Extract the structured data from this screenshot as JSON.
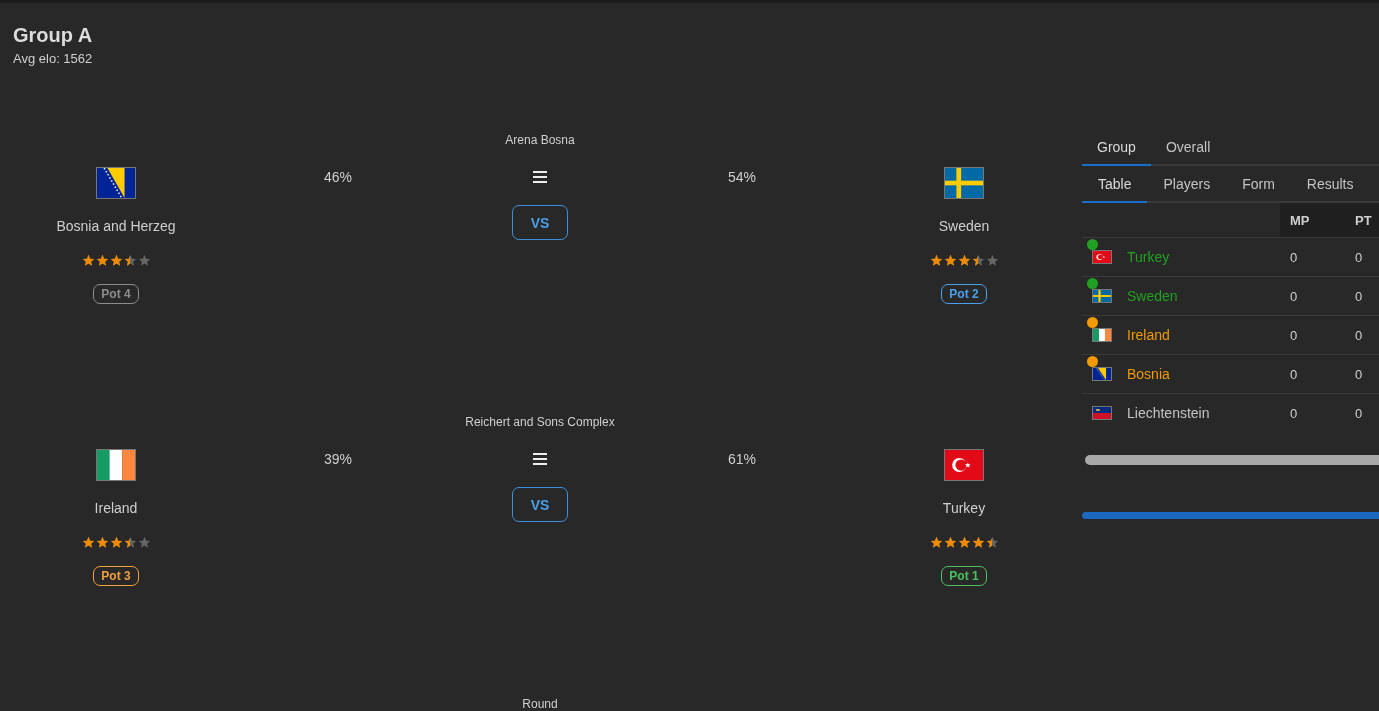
{
  "header": {
    "title": "Group A",
    "subtitle": "Avg elo: 1562"
  },
  "matches": [
    {
      "venue": "Arena Bosna",
      "vs_label": "VS",
      "home": {
        "name": "Bosnia and Herzeg",
        "kind": "bosnia",
        "stars": 3.5,
        "pot": {
          "label": "Pot 4",
          "color": "#8c8c8c"
        },
        "chance": "46%"
      },
      "away": {
        "name": "Sweden",
        "kind": "sweden",
        "stars": 3.5,
        "pot": {
          "label": "Pot 2",
          "color": "#4aa0ea"
        },
        "chance": "54%"
      }
    },
    {
      "venue": "Reichert and Sons Complex",
      "vs_label": "VS",
      "home": {
        "name": "Ireland",
        "kind": "ireland",
        "stars": 3.5,
        "pot": {
          "label": "Pot 3",
          "color": "#f0a040"
        },
        "chance": "39%"
      },
      "away": {
        "name": "Turkey",
        "kind": "turkey",
        "stars": 4.5,
        "pot": {
          "label": "Pot 1",
          "color": "#4cc25c"
        },
        "chance": "61%"
      }
    },
    {
      "venue": "Round"
    }
  ],
  "standings": {
    "tabs": [
      {
        "label": "Group",
        "selected": true
      },
      {
        "label": "Overall",
        "selected": false
      }
    ],
    "subtabs": [
      {
        "label": "Table",
        "selected": true
      },
      {
        "label": "Players",
        "selected": false
      },
      {
        "label": "Form",
        "selected": false
      },
      {
        "label": "Results",
        "selected": false
      }
    ],
    "columns": [
      "MP",
      "PT"
    ],
    "rows": [
      {
        "name": "Turkey",
        "kind": "turkey",
        "color": "#22a022",
        "values": [
          "0",
          "0"
        ]
      },
      {
        "name": "Sweden",
        "kind": "sweden",
        "color": "#22a022",
        "values": [
          "0",
          "0"
        ]
      },
      {
        "name": "Ireland",
        "kind": "ireland",
        "color": "#f29a00",
        "values": [
          "0",
          "0"
        ]
      },
      {
        "name": "Bosnia",
        "kind": "bosnia",
        "color": "#f29a00",
        "values": [
          "0",
          "0"
        ]
      },
      {
        "name": "Liechtenstein",
        "kind": "liechtenstein",
        "values": [
          "0",
          "0"
        ]
      }
    ]
  }
}
